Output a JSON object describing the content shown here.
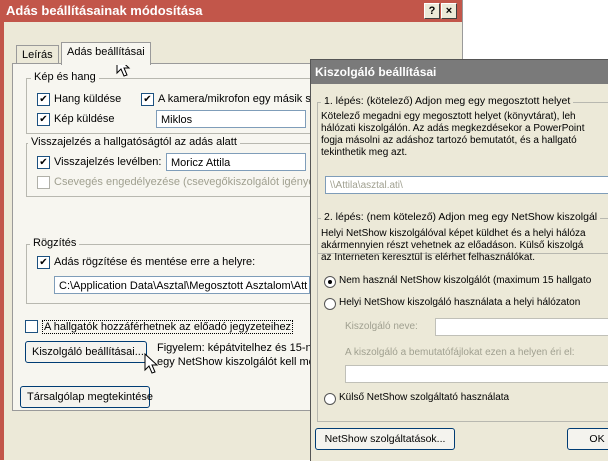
{
  "main_dialog": {
    "title": "Adás beállításainak módosítása",
    "help_label": "?",
    "close_label": "×",
    "tabs": [
      {
        "label": "Leírás"
      },
      {
        "label": "Adás beállításai"
      }
    ],
    "groups": {
      "picture_sound": {
        "label": "Kép és hang",
        "send_sound_label": "Hang küldése",
        "camera_label": "A kamera/mikrofon egy másik sz",
        "send_picture_label": "Kép küldése",
        "picture_source_value": "Miklos"
      },
      "feedback": {
        "label": "Visszajelzés a hallgatóságtól az adás alatt",
        "email_feedback_label": "Visszajelzés levélben:",
        "email_feedback_value": "Moricz Attila",
        "chat_label": "Csevegés engedélyezése (csevegőkiszolgálót igénye"
      },
      "recording": {
        "label": "Rögzítés",
        "record_label": "Adás rögzítése és mentése erre a helyre:",
        "record_path": "C:\\Application Data\\Asztal\\Megosztott Asztalom\\Att"
      }
    },
    "notes_access_label": "A hallgatók hozzáférhetnek az előadó jegyzeteihez",
    "server_settings_button": "Kiszolgáló beállításai...",
    "warning_lines": [
      "Figyelem: képátvitelhez és 15-n",
      "egy NetShow kiszolgálót kell me"
    ],
    "lobby_button": "Társalgólap megtekintése"
  },
  "server_dialog": {
    "title": "Kiszolgáló beállításai",
    "step1": {
      "label": "1. lépés: (kötelező) Adjon meg egy megosztott helyet",
      "text_lines": [
        "Kötelező megadni egy megosztott helyet (könyvtárat), leh",
        "hálózati kiszolgálón. Az adás megkezdésekor a PowerPoint",
        "fogja másolni az adáshoz tartozó bemutatót, és a hallgató",
        "tekinthetik meg azt."
      ],
      "path_value": "\\\\Attila\\asztal.ati\\"
    },
    "step2": {
      "label": "2. lépés: (nem kötelező) Adjon meg egy NetShow kiszolgál",
      "text_lines": [
        "Helyi NetShow kiszolgálóval képet küldhet és a helyi hálóza",
        "akármennyien részt vehetnek az előadáson. Külső kiszolgá",
        "az Interneten keresztül is elérhet felhasználókat."
      ],
      "option_none": "Nem használ NetShow kiszolgálót (maximum 15 hallgato",
      "option_local": "Helyi NetShow kiszolgáló használata a helyi hálózaton",
      "server_name_label": "Kiszolgáló neve:",
      "server_name_value": "",
      "server_path_label": "A kiszolgáló a bemutatófájlokat ezen a helyen éri el:",
      "server_path_value": "",
      "option_external": "Külső NetShow szolgáltató használata"
    },
    "netshow_services_button": "NetShow szolgáltatások...",
    "ok_button": "OK"
  },
  "colors": {
    "main_title_bar": "#c2564a",
    "dialog_face": "#ece9d8",
    "inactive_title_bar": "#7a7a7a"
  }
}
